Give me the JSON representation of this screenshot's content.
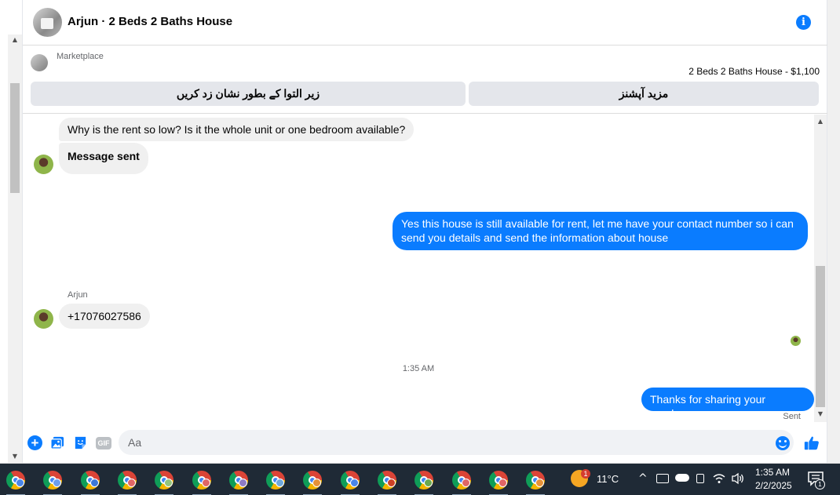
{
  "header": {
    "title": "Arjun · 2 Beds 2 Baths House",
    "info_icon": "info-icon"
  },
  "marketplace": {
    "label": "Marketplace",
    "listing": "2 Beds 2 Baths House - $1,100",
    "mark_button": "زیر التوا کے بطور نشان زد کریں",
    "more_button": "مزید آپشنز"
  },
  "messages": {
    "m1": "Why is the rent so low? Is it the whole unit or one bedroom available?",
    "m2": "Message sent",
    "m3": "Yes this house is still available for rent, let me have your contact number so i can send you details and send the information about house",
    "sender": "Arjun",
    "m4": "+17076027586",
    "timestamp": "1:35 AM",
    "m5": "Thanks for sharing your number",
    "status": "Sent"
  },
  "composer": {
    "placeholder": "Aa",
    "gif_label": "GIF"
  },
  "taskbar": {
    "apps": [
      "chrome",
      "chrome",
      "chrome",
      "chrome",
      "chrome",
      "chrome",
      "chrome",
      "chrome",
      "chrome",
      "chrome",
      "chrome",
      "chrome",
      "chrome",
      "chrome",
      "chrome"
    ],
    "weather_badge": "1",
    "temperature": "11°C",
    "time": "1:35 AM",
    "date": "2/2/2025",
    "notification_count": "1"
  },
  "colors": {
    "accent": "#0a7cff",
    "incoming_bubble": "#f0f0f0",
    "taskbar": "#1f2a36"
  }
}
